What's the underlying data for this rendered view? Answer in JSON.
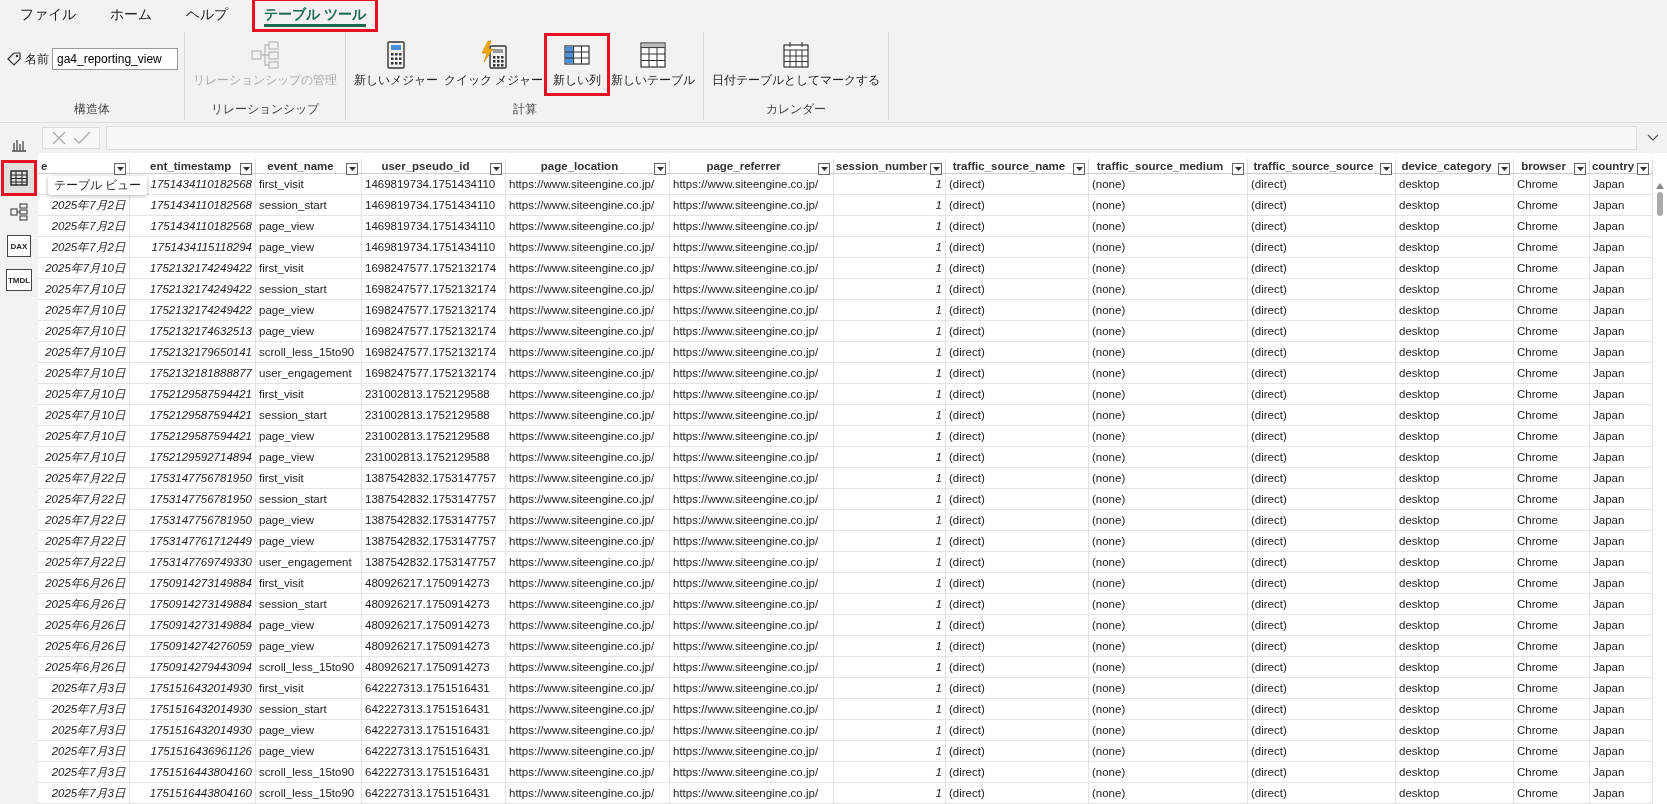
{
  "menu_tabs": [
    {
      "label": "ファイル",
      "selected": false,
      "highlighted": false
    },
    {
      "label": "ホーム",
      "selected": false,
      "highlighted": false
    },
    {
      "label": "ヘルプ",
      "selected": false,
      "highlighted": false
    },
    {
      "label": "テーブル ツール",
      "selected": true,
      "highlighted": true
    }
  ],
  "ribbon": {
    "groups": [
      {
        "label": "構造体",
        "kind": "name",
        "name_label": "名前",
        "name_value": "ga4_reporting_view"
      },
      {
        "label": "リレーションシップ",
        "kind": "buttons",
        "buttons": [
          {
            "label": "リレーションシップの管理",
            "kind": "relationship",
            "disabled": true,
            "highlighted": false
          }
        ]
      },
      {
        "label": "計算",
        "kind": "buttons",
        "buttons": [
          {
            "label": "新しいメジャー",
            "kind": "measure",
            "disabled": false,
            "highlighted": false
          },
          {
            "label": "クイック メジャー",
            "kind": "quick",
            "disabled": false,
            "highlighted": false
          },
          {
            "label": "新しい列",
            "kind": "column",
            "disabled": false,
            "highlighted": true
          },
          {
            "label": "新しいテーブル",
            "kind": "table",
            "disabled": false,
            "highlighted": false
          }
        ]
      },
      {
        "label": "カレンダー",
        "kind": "buttons",
        "buttons": [
          {
            "label": "日付テーブルとしてマークする",
            "kind": "calendar",
            "disabled": false,
            "highlighted": false
          }
        ]
      }
    ]
  },
  "sidebar": {
    "items": [
      {
        "kind": "report",
        "selected": false,
        "highlighted": false
      },
      {
        "kind": "table",
        "selected": true,
        "highlighted": true
      },
      {
        "kind": "model",
        "selected": false,
        "highlighted": false
      },
      {
        "kind": "dax",
        "label": "DAX",
        "selected": false,
        "highlighted": false
      },
      {
        "kind": "tmdl",
        "label": "TMDL",
        "selected": false,
        "highlighted": false
      }
    ]
  },
  "tooltip": "テーブル ビュー",
  "formula_bar": {
    "disabled": true
  },
  "table": {
    "columns": [
      {
        "label": "e",
        "kind": "date"
      },
      {
        "label": "ent_timestamp",
        "kind": "number"
      },
      {
        "label": "event_name",
        "kind": "text"
      },
      {
        "label": "user_pseudo_id",
        "kind": "text"
      },
      {
        "label": "page_location",
        "kind": "text"
      },
      {
        "label": "page_referrer",
        "kind": "text"
      },
      {
        "label": "session_number",
        "kind": "number"
      },
      {
        "label": "traffic_source_name",
        "kind": "text"
      },
      {
        "label": "traffic_source_medium",
        "kind": "text"
      },
      {
        "label": "traffic_source_source",
        "kind": "text"
      },
      {
        "label": "device_category",
        "kind": "text"
      },
      {
        "label": "browser",
        "kind": "text"
      },
      {
        "label": "country",
        "kind": "text"
      }
    ],
    "rows": [
      [
        null,
        "1751434110182568",
        "first_visit",
        "1469819734.1751434110",
        "https://www.siteengine.co.jp/",
        "https://www.siteengine.co.jp/",
        "1",
        "(direct)",
        "(none)",
        "(direct)",
        "desktop",
        "Chrome",
        "Japan"
      ],
      [
        "2025年7月2日",
        "1751434110182568",
        "session_start",
        "1469819734.1751434110",
        "https://www.siteengine.co.jp/",
        "https://www.siteengine.co.jp/",
        "1",
        "(direct)",
        "(none)",
        "(direct)",
        "desktop",
        "Chrome",
        "Japan"
      ],
      [
        "2025年7月2日",
        "1751434110182568",
        "page_view",
        "1469819734.1751434110",
        "https://www.siteengine.co.jp/",
        "https://www.siteengine.co.jp/",
        "1",
        "(direct)",
        "(none)",
        "(direct)",
        "desktop",
        "Chrome",
        "Japan"
      ],
      [
        "2025年7月2日",
        "1751434115118294",
        "page_view",
        "1469819734.1751434110",
        "https://www.siteengine.co.jp/",
        "https://www.siteengine.co.jp/",
        "1",
        "(direct)",
        "(none)",
        "(direct)",
        "desktop",
        "Chrome",
        "Japan"
      ],
      [
        "2025年7月10日",
        "1752132174249422",
        "first_visit",
        "1698247577.1752132174",
        "https://www.siteengine.co.jp/",
        "https://www.siteengine.co.jp/",
        "1",
        "(direct)",
        "(none)",
        "(direct)",
        "desktop",
        "Chrome",
        "Japan"
      ],
      [
        "2025年7月10日",
        "1752132174249422",
        "session_start",
        "1698247577.1752132174",
        "https://www.siteengine.co.jp/",
        "https://www.siteengine.co.jp/",
        "1",
        "(direct)",
        "(none)",
        "(direct)",
        "desktop",
        "Chrome",
        "Japan"
      ],
      [
        "2025年7月10日",
        "1752132174249422",
        "page_view",
        "1698247577.1752132174",
        "https://www.siteengine.co.jp/",
        "https://www.siteengine.co.jp/",
        "1",
        "(direct)",
        "(none)",
        "(direct)",
        "desktop",
        "Chrome",
        "Japan"
      ],
      [
        "2025年7月10日",
        "1752132174632513",
        "page_view",
        "1698247577.1752132174",
        "https://www.siteengine.co.jp/",
        "https://www.siteengine.co.jp/",
        "1",
        "(direct)",
        "(none)",
        "(direct)",
        "desktop",
        "Chrome",
        "Japan"
      ],
      [
        "2025年7月10日",
        "1752132179650141",
        "scroll_less_15to90",
        "1698247577.1752132174",
        "https://www.siteengine.co.jp/",
        "https://www.siteengine.co.jp/",
        "1",
        "(direct)",
        "(none)",
        "(direct)",
        "desktop",
        "Chrome",
        "Japan"
      ],
      [
        "2025年7月10日",
        "1752132181888877",
        "user_engagement",
        "1698247577.1752132174",
        "https://www.siteengine.co.jp/",
        "https://www.siteengine.co.jp/",
        "1",
        "(direct)",
        "(none)",
        "(direct)",
        "desktop",
        "Chrome",
        "Japan"
      ],
      [
        "2025年7月10日",
        "1752129587594421",
        "first_visit",
        "231002813.1752129588",
        "https://www.siteengine.co.jp/",
        "https://www.siteengine.co.jp/",
        "1",
        "(direct)",
        "(none)",
        "(direct)",
        "desktop",
        "Chrome",
        "Japan"
      ],
      [
        "2025年7月10日",
        "1752129587594421",
        "session_start",
        "231002813.1752129588",
        "https://www.siteengine.co.jp/",
        "https://www.siteengine.co.jp/",
        "1",
        "(direct)",
        "(none)",
        "(direct)",
        "desktop",
        "Chrome",
        "Japan"
      ],
      [
        "2025年7月10日",
        "1752129587594421",
        "page_view",
        "231002813.1752129588",
        "https://www.siteengine.co.jp/",
        "https://www.siteengine.co.jp/",
        "1",
        "(direct)",
        "(none)",
        "(direct)",
        "desktop",
        "Chrome",
        "Japan"
      ],
      [
        "2025年7月10日",
        "1752129592714894",
        "page_view",
        "231002813.1752129588",
        "https://www.siteengine.co.jp/",
        "https://www.siteengine.co.jp/",
        "1",
        "(direct)",
        "(none)",
        "(direct)",
        "desktop",
        "Chrome",
        "Japan"
      ],
      [
        "2025年7月22日",
        "1753147756781950",
        "first_visit",
        "1387542832.1753147757",
        "https://www.siteengine.co.jp/",
        "https://www.siteengine.co.jp/",
        "1",
        "(direct)",
        "(none)",
        "(direct)",
        "desktop",
        "Chrome",
        "Japan"
      ],
      [
        "2025年7月22日",
        "1753147756781950",
        "session_start",
        "1387542832.1753147757",
        "https://www.siteengine.co.jp/",
        "https://www.siteengine.co.jp/",
        "1",
        "(direct)",
        "(none)",
        "(direct)",
        "desktop",
        "Chrome",
        "Japan"
      ],
      [
        "2025年7月22日",
        "1753147756781950",
        "page_view",
        "1387542832.1753147757",
        "https://www.siteengine.co.jp/",
        "https://www.siteengine.co.jp/",
        "1",
        "(direct)",
        "(none)",
        "(direct)",
        "desktop",
        "Chrome",
        "Japan"
      ],
      [
        "2025年7月22日",
        "1753147761712449",
        "page_view",
        "1387542832.1753147757",
        "https://www.siteengine.co.jp/",
        "https://www.siteengine.co.jp/",
        "1",
        "(direct)",
        "(none)",
        "(direct)",
        "desktop",
        "Chrome",
        "Japan"
      ],
      [
        "2025年7月22日",
        "1753147769749330",
        "user_engagement",
        "1387542832.1753147757",
        "https://www.siteengine.co.jp/",
        "https://www.siteengine.co.jp/",
        "1",
        "(direct)",
        "(none)",
        "(direct)",
        "desktop",
        "Chrome",
        "Japan"
      ],
      [
        "2025年6月26日",
        "1750914273149884",
        "first_visit",
        "480926217.1750914273",
        "https://www.siteengine.co.jp/",
        "https://www.siteengine.co.jp/",
        "1",
        "(direct)",
        "(none)",
        "(direct)",
        "desktop",
        "Chrome",
        "Japan"
      ],
      [
        "2025年6月26日",
        "1750914273149884",
        "session_start",
        "480926217.1750914273",
        "https://www.siteengine.co.jp/",
        "https://www.siteengine.co.jp/",
        "1",
        "(direct)",
        "(none)",
        "(direct)",
        "desktop",
        "Chrome",
        "Japan"
      ],
      [
        "2025年6月26日",
        "1750914273149884",
        "page_view",
        "480926217.1750914273",
        "https://www.siteengine.co.jp/",
        "https://www.siteengine.co.jp/",
        "1",
        "(direct)",
        "(none)",
        "(direct)",
        "desktop",
        "Chrome",
        "Japan"
      ],
      [
        "2025年6月26日",
        "1750914274276059",
        "page_view",
        "480926217.1750914273",
        "https://www.siteengine.co.jp/",
        "https://www.siteengine.co.jp/",
        "1",
        "(direct)",
        "(none)",
        "(direct)",
        "desktop",
        "Chrome",
        "Japan"
      ],
      [
        "2025年6月26日",
        "1750914279443094",
        "scroll_less_15to90",
        "480926217.1750914273",
        "https://www.siteengine.co.jp/",
        "https://www.siteengine.co.jp/",
        "1",
        "(direct)",
        "(none)",
        "(direct)",
        "desktop",
        "Chrome",
        "Japan"
      ],
      [
        "2025年7月3日",
        "1751516432014930",
        "first_visit",
        "642227313.1751516431",
        "https://www.siteengine.co.jp/",
        "https://www.siteengine.co.jp/",
        "1",
        "(direct)",
        "(none)",
        "(direct)",
        "desktop",
        "Chrome",
        "Japan"
      ],
      [
        "2025年7月3日",
        "1751516432014930",
        "session_start",
        "642227313.1751516431",
        "https://www.siteengine.co.jp/",
        "https://www.siteengine.co.jp/",
        "1",
        "(direct)",
        "(none)",
        "(direct)",
        "desktop",
        "Chrome",
        "Japan"
      ],
      [
        "2025年7月3日",
        "1751516432014930",
        "page_view",
        "642227313.1751516431",
        "https://www.siteengine.co.jp/",
        "https://www.siteengine.co.jp/",
        "1",
        "(direct)",
        "(none)",
        "(direct)",
        "desktop",
        "Chrome",
        "Japan"
      ],
      [
        "2025年7月3日",
        "1751516436961126",
        "page_view",
        "642227313.1751516431",
        "https://www.siteengine.co.jp/",
        "https://www.siteengine.co.jp/",
        "1",
        "(direct)",
        "(none)",
        "(direct)",
        "desktop",
        "Chrome",
        "Japan"
      ],
      [
        "2025年7月3日",
        "1751516443804160",
        "scroll_less_15to90",
        "642227313.1751516431",
        "https://www.siteengine.co.jp/",
        "https://www.siteengine.co.jp/",
        "1",
        "(direct)",
        "(none)",
        "(direct)",
        "desktop",
        "Chrome",
        "Japan"
      ],
      [
        "2025年7月3日",
        "1751516443804160",
        "scroll_less_15to90",
        "642227313.1751516431",
        "https://www.siteengine.co.jp/",
        "https://www.siteengine.co.jp/",
        "1",
        "(direct)",
        "(none)",
        "(direct)",
        "desktop",
        "Chrome",
        "Japan"
      ]
    ]
  }
}
